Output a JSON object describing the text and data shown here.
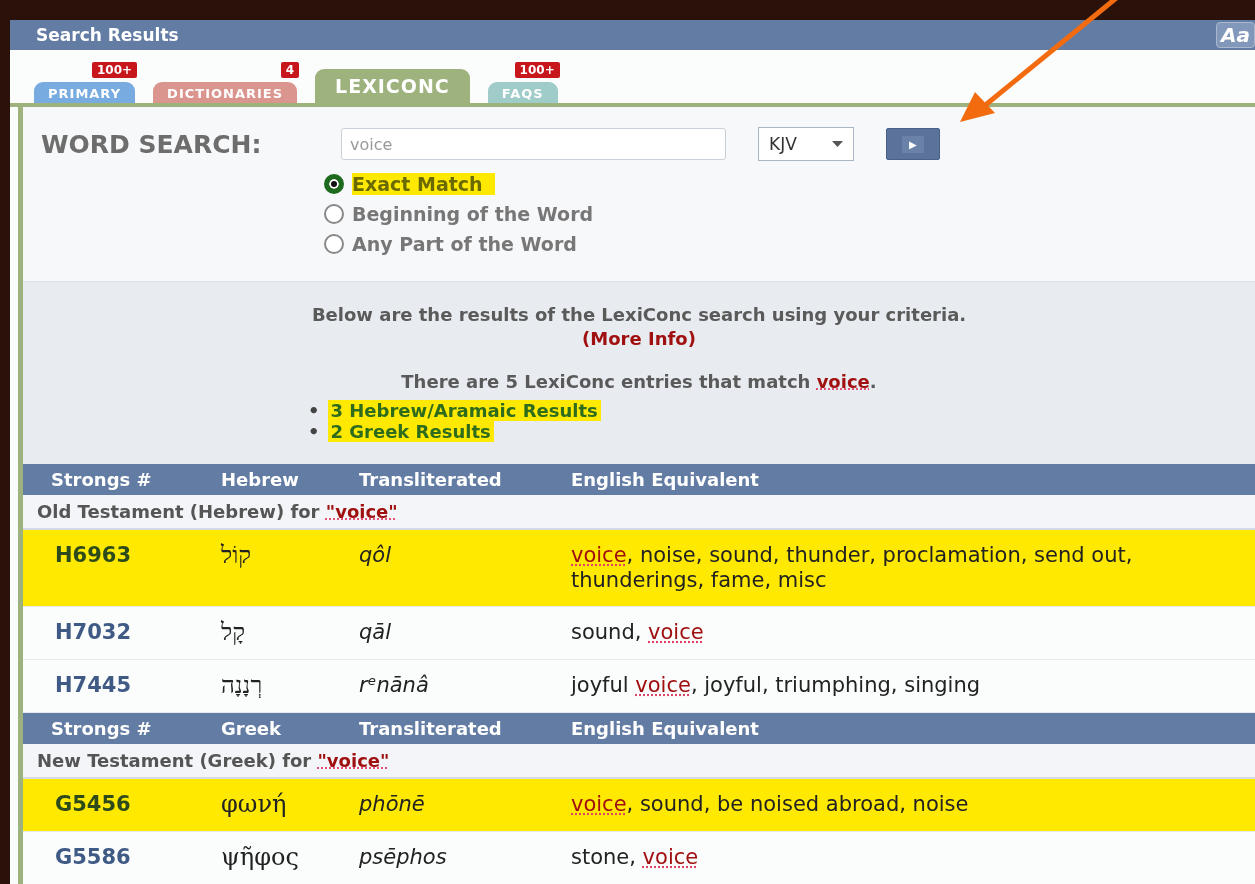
{
  "window": {
    "title": "Search Results",
    "font_button": "Aa"
  },
  "tabs": [
    {
      "label": "PRIMARY",
      "badge": "100+",
      "color": "#6aa3dc",
      "selected": false
    },
    {
      "label": "DICTIONARIES",
      "badge": "4",
      "color": "#d88a84",
      "selected": false
    },
    {
      "label": "LEXICONC",
      "color": "#9db27c",
      "selected": true
    },
    {
      "label": "FAQS",
      "badge": "100+",
      "color": "#96c6c4",
      "selected": false
    }
  ],
  "search": {
    "label": "WORD SEARCH:",
    "value": "voice",
    "version": "KJV",
    "go_symbol": "▶",
    "options": [
      {
        "label": "Exact Match",
        "selected": true,
        "highlighted": true
      },
      {
        "label": "Beginning of the Word",
        "selected": false,
        "highlighted": false
      },
      {
        "label": "Any Part of the Word",
        "selected": false,
        "highlighted": false
      }
    ]
  },
  "summary": {
    "intro": "Below are the results of the LexiConc search using your criteria.",
    "more_info": "(More Info)",
    "count_before": "There are 5 LexiConc entries that match ",
    "count_term": "voice",
    "count_after": ".",
    "links": [
      {
        "marker": "•",
        "label": "3 Hebrew/Aramaic Results",
        "highlighted": true
      },
      {
        "marker": "•",
        "label": "2 Greek Results",
        "highlighted": true
      }
    ]
  },
  "sections": [
    {
      "columns": [
        "Strongs #",
        "Hebrew",
        "Transliterated",
        "English Equivalent"
      ],
      "caption": "Old Testament (Hebrew) for ",
      "caption_term": "\"voice\"",
      "rows": [
        {
          "strongs": "H6963",
          "word": "קוֹל",
          "translit": "qôl",
          "highlighted": true,
          "english": [
            {
              "text": "voice",
              "match": true
            },
            {
              "text": ", noise, sound, thunder, proclamation, send out, thunderings, fame, misc",
              "match": false
            }
          ]
        },
        {
          "strongs": "H7032",
          "word": "קָל",
          "translit": "qāl",
          "highlighted": false,
          "english": [
            {
              "text": "sound, ",
              "match": false
            },
            {
              "text": "voice",
              "match": true
            }
          ]
        },
        {
          "strongs": "H7445",
          "word": "רְנָנָה",
          "translit": "rᵉnānâ",
          "highlighted": false,
          "english": [
            {
              "text": "joyful ",
              "match": false
            },
            {
              "text": "voice",
              "match": true
            },
            {
              "text": ", joyful, triumphing, singing",
              "match": false
            }
          ]
        }
      ]
    },
    {
      "columns": [
        "Strongs #",
        "Greek",
        "Transliterated",
        "English Equivalent"
      ],
      "caption": "New Testament (Greek) for ",
      "caption_term": "\"voice\"",
      "rows": [
        {
          "strongs": "G5456",
          "word": "φωνή",
          "translit": "phōnē",
          "highlighted": true,
          "english": [
            {
              "text": "voice",
              "match": true
            },
            {
              "text": ", sound, be noised abroad, noise",
              "match": false
            }
          ]
        },
        {
          "strongs": "G5586",
          "word": "ψῆφος",
          "translit": "psēphos",
          "highlighted": false,
          "english": [
            {
              "text": "stone, ",
              "match": false
            },
            {
              "text": "voice",
              "match": true
            }
          ]
        }
      ]
    }
  ]
}
